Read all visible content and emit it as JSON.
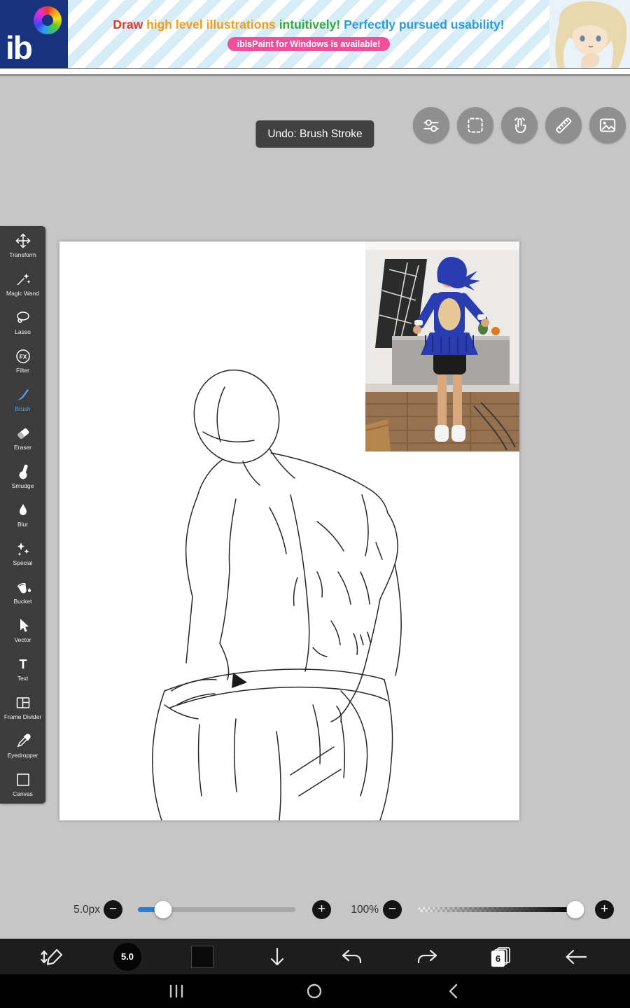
{
  "banner": {
    "logo_text": "ib",
    "headline": [
      {
        "text": "Draw ",
        "color": "#e03a2a"
      },
      {
        "text": "high level illustrations ",
        "color": "#f09c1e"
      },
      {
        "text": "intuitively! ",
        "color": "#35aa3c"
      },
      {
        "text": "Perfectly pursued usability!",
        "color": "#2b9bd7"
      }
    ],
    "badge": "ibisPaint for Windows is available!"
  },
  "workspace": {
    "undo_toast": "Undo: Brush Stroke",
    "top_buttons": [
      "quick-settings",
      "marquee-select",
      "touch-gesture",
      "ruler",
      "material"
    ]
  },
  "toolbar": {
    "items": [
      {
        "label": "Transform"
      },
      {
        "label": "Magic Wand"
      },
      {
        "label": "Lasso"
      },
      {
        "label": "Filter",
        "icon_text": "FX"
      },
      {
        "label": "Brush",
        "active": true
      },
      {
        "label": "Eraser"
      },
      {
        "label": "Smudge"
      },
      {
        "label": "Blur"
      },
      {
        "label": "Special"
      },
      {
        "label": "Bucket"
      },
      {
        "label": "Vector"
      },
      {
        "label": "Text",
        "icon_text": "T"
      },
      {
        "label": "Frame Divider"
      },
      {
        "label": "Eyedropper"
      },
      {
        "label": "Canvas"
      }
    ]
  },
  "sliders": {
    "brush_size": {
      "label": "5.0px",
      "fill": "16%",
      "thumb": "16%"
    },
    "opacity": {
      "label": "100%",
      "thumb": "100%"
    }
  },
  "bottom_bar": {
    "brush_size_value": "5.0",
    "layer_count": "6"
  },
  "icons": {
    "minus": "−",
    "plus": "+"
  },
  "colors": {
    "accent_blue": "#4da3ff",
    "slider_blue": "#2e7bd6",
    "badge_pink": "#f0509b"
  }
}
